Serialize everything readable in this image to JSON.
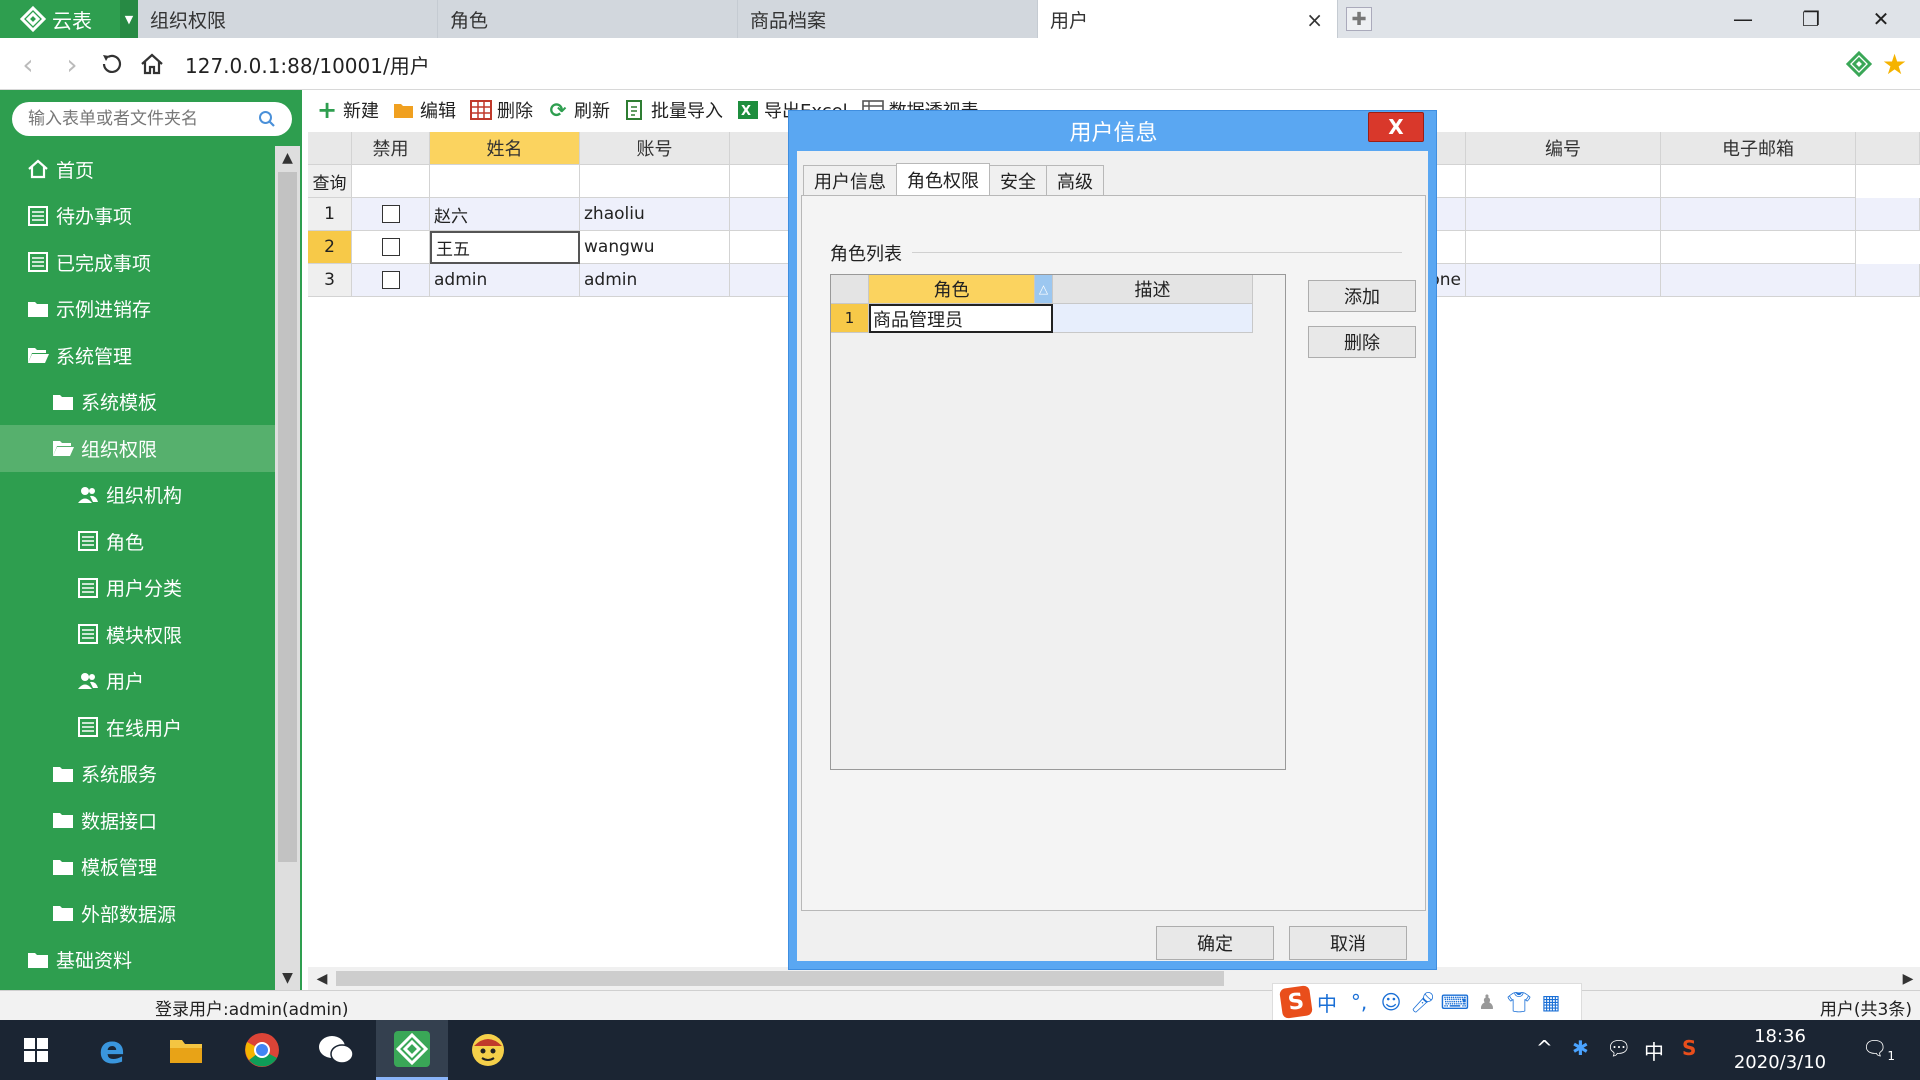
{
  "app": {
    "name": "云表"
  },
  "tabs": [
    {
      "label": "组织权限",
      "active": false
    },
    {
      "label": "角色",
      "active": false
    },
    {
      "label": "商品档案",
      "active": false
    },
    {
      "label": "用户",
      "active": true
    }
  ],
  "tab_close": "×",
  "address": {
    "url": "127.0.0.1:88/10001/用户"
  },
  "sidebar": {
    "search_placeholder": "输入表单或者文件夹名",
    "items": [
      {
        "label": "首页",
        "icon": "home-icon",
        "level": 0
      },
      {
        "label": "待办事项",
        "icon": "list-icon",
        "level": 0
      },
      {
        "label": "已完成事项",
        "icon": "list-icon",
        "level": 0
      },
      {
        "label": "示例进销存",
        "icon": "folder-icon",
        "level": 0
      },
      {
        "label": "系统管理",
        "icon": "folder-open-icon",
        "level": 0
      },
      {
        "label": "系统模板",
        "icon": "folder-icon",
        "level": 1
      },
      {
        "label": "组织权限",
        "icon": "folder-open-icon",
        "level": 1,
        "active": true
      },
      {
        "label": "组织机构",
        "icon": "users-icon",
        "level": 2
      },
      {
        "label": "角色",
        "icon": "list-icon",
        "level": 2
      },
      {
        "label": "用户分类",
        "icon": "list-icon",
        "level": 2
      },
      {
        "label": "模块权限",
        "icon": "list-icon",
        "level": 2
      },
      {
        "label": "用户",
        "icon": "users-icon",
        "level": 2
      },
      {
        "label": "在线用户",
        "icon": "list-icon",
        "level": 2
      },
      {
        "label": "系统服务",
        "icon": "folder-icon",
        "level": 1
      },
      {
        "label": "数据接口",
        "icon": "folder-icon",
        "level": 1
      },
      {
        "label": "模板管理",
        "icon": "folder-icon",
        "level": 1
      },
      {
        "label": "外部数据源",
        "icon": "folder-icon",
        "level": 1
      },
      {
        "label": "基础资料",
        "icon": "folder-icon",
        "level": 0
      }
    ]
  },
  "toolbar": {
    "new": "新建",
    "edit": "编辑",
    "delete": "删除",
    "refresh": "刷新",
    "import": "批量导入",
    "export": "导出Excel",
    "pivot": "数据透视表"
  },
  "grid": {
    "headers": {
      "disabled": "禁用",
      "name": "姓名",
      "account": "账号",
      "code": "编号",
      "email": "电子邮箱"
    },
    "query_label": "查询",
    "rows": [
      {
        "num": "1",
        "name": "赵六",
        "account": "zhaoliu",
        "group": ""
      },
      {
        "num": "2",
        "name": "王五",
        "account": "wangwu",
        "group": ""
      },
      {
        "num": "3",
        "name": "admin",
        "account": "admin",
        "group": "everyone"
      }
    ]
  },
  "dialog": {
    "title": "用户信息",
    "close": "X",
    "tabs": [
      "用户信息",
      "角色权限",
      "安全",
      "高级"
    ],
    "active_tab": "角色权限",
    "role_list_label": "角色列表",
    "role_grid": {
      "headers": {
        "role": "角色",
        "desc": "描述"
      },
      "rows": [
        {
          "num": "1",
          "role": "商品管理员",
          "desc": ""
        }
      ]
    },
    "add": "添加",
    "remove": "删除",
    "ok": "确定",
    "cancel": "取消"
  },
  "status": {
    "login": "登录用户:admin(admin)",
    "count": "用户(共3条)"
  },
  "ime": {
    "mode": "中",
    "punct": "°,"
  },
  "taskbar": {
    "time": "18:36",
    "date": "2020/3/10",
    "lang": "中",
    "notify_count": "1"
  },
  "colors": {
    "brand_green": "#2e9e4f",
    "dialog_blue": "#5aa7f2",
    "close_red": "#d9382b",
    "selected_header": "#fbd35f"
  }
}
